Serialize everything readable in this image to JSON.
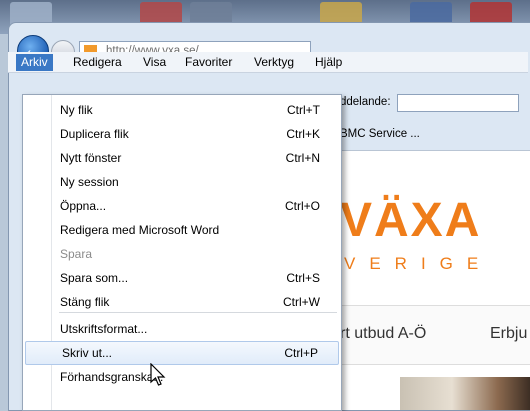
{
  "browser": {
    "url": "http://www.vxa.se/",
    "menubar": [
      "Arkiv",
      "Redigera",
      "Visa",
      "Favoriter",
      "Verktyg",
      "Hjälp"
    ],
    "toolbar_label": "ddelande:",
    "favorites_item": "BMC Service ...",
    "back_icon": "back-arrow-icon",
    "forward_icon": "forward-arrow-icon"
  },
  "page": {
    "logo_main": "VÄXA",
    "logo_sub": "VERIGE",
    "nav_link_1": "rt utbud A-Ö",
    "nav_link_2": "Erbju",
    "accent_color": "#ef7d1a"
  },
  "file_menu": {
    "items": [
      {
        "label": "Ny flik",
        "shortcut": "Ctrl+T"
      },
      {
        "label": "Duplicera flik",
        "shortcut": "Ctrl+K"
      },
      {
        "label": "Nytt fönster",
        "shortcut": "Ctrl+N"
      },
      {
        "label": "Ny session",
        "shortcut": ""
      },
      {
        "label": "Öppna...",
        "shortcut": "Ctrl+O"
      },
      {
        "label": "Redigera med Microsoft Word",
        "shortcut": ""
      },
      {
        "label": "Spara",
        "shortcut": "",
        "disabled": true
      },
      {
        "label": "Spara som...",
        "shortcut": "Ctrl+S"
      },
      {
        "label": "Stäng flik",
        "shortcut": "Ctrl+W"
      },
      {
        "label": "Utskriftsformat...",
        "shortcut": ""
      },
      {
        "label": "Skriv ut...",
        "shortcut": "Ctrl+P"
      },
      {
        "label": "Förhandsgranska...",
        "shortcut": ""
      }
    ]
  }
}
